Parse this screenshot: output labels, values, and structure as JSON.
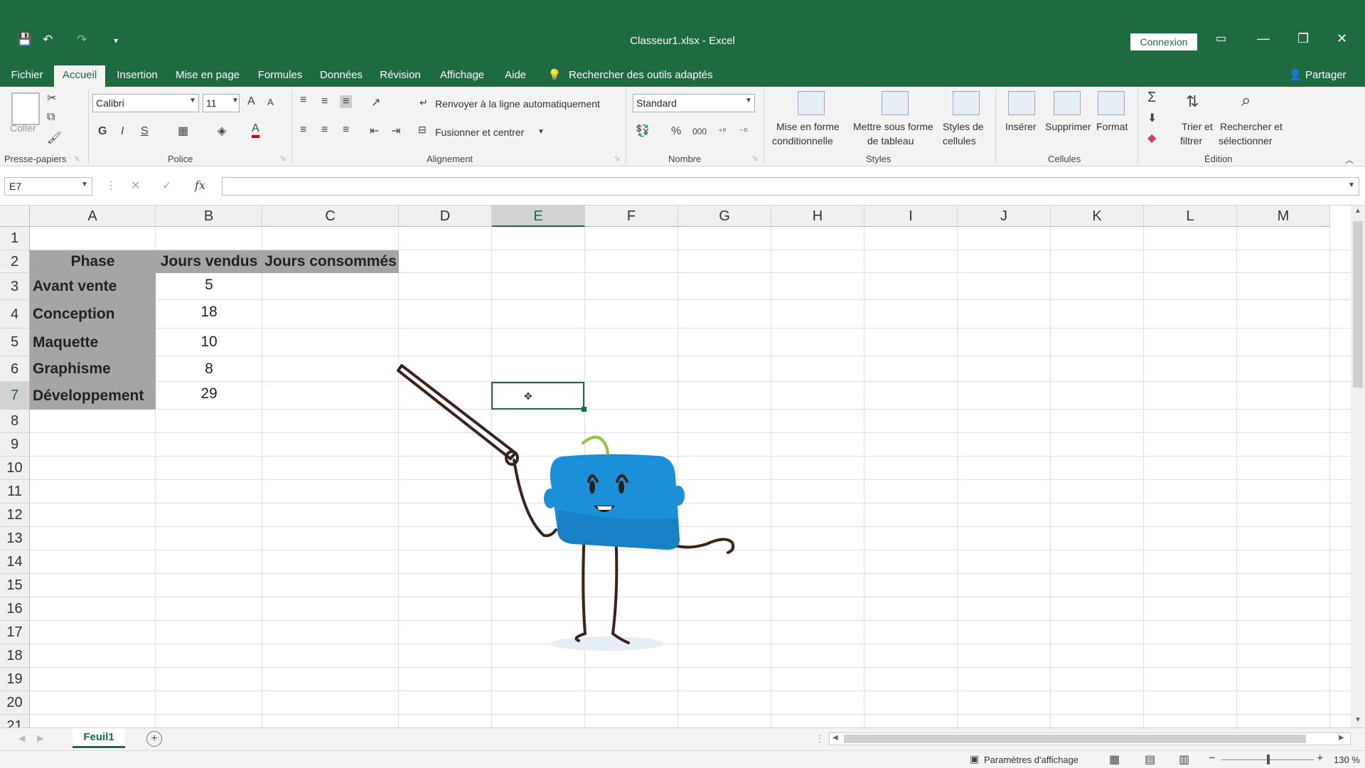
{
  "app": {
    "title": "Classeur1.xlsx  -  Excel",
    "connexion": "Connexion",
    "icons": [
      "save-icon",
      "undo-icon",
      "redo-icon",
      "customize-icon",
      "ribbon-display-icon",
      "minimize-icon",
      "restore-icon",
      "close-icon"
    ]
  },
  "tabs": [
    "Fichier",
    "Accueil",
    "Insertion",
    "Mise en page",
    "Formules",
    "Données",
    "Révision",
    "Affichage",
    "Aide"
  ],
  "tellme": "Rechercher des outils adaptés",
  "share": "Partager",
  "ribbon": {
    "clipboard": {
      "paste": "Coller",
      "group": "Presse-papiers"
    },
    "font": {
      "name": "Calibri",
      "size": "11",
      "bold": "G",
      "italic": "I",
      "underline": "S",
      "group": "Police"
    },
    "alignment": {
      "wrap": "Renvoyer à la ligne automatiquement",
      "merge": "Fusionner et centrer",
      "group": "Alignement"
    },
    "number": {
      "format": "Standard",
      "percent": "%",
      "thousands": "000",
      "group": "Nombre"
    },
    "styles": {
      "cond1": "Mise en forme",
      "cond2": "conditionnelle",
      "table1": "Mettre sous forme",
      "table2": "de tableau",
      "cell1": "Styles de",
      "cell2": "cellules",
      "group": "Styles"
    },
    "cells": {
      "insert": "Insérer",
      "delete": "Supprimer",
      "format": "Format",
      "group": "Cellules"
    },
    "editing": {
      "sum": "Σ",
      "sort1": "Trier et",
      "sort2": "filtrer",
      "find1": "Rechercher et",
      "find2": "sélectionner",
      "group": "Édition"
    }
  },
  "formula_bar": {
    "name_box": "E7",
    "fx": "fx",
    "value": ""
  },
  "grid": {
    "columns": [
      "A",
      "B",
      "C",
      "D",
      "E",
      "F",
      "G",
      "H",
      "I",
      "J",
      "K",
      "L",
      "M"
    ],
    "rows": [
      "1",
      "2",
      "3",
      "4",
      "5",
      "6",
      "7",
      "8",
      "9",
      "10",
      "11",
      "12",
      "13",
      "14",
      "15",
      "16",
      "17",
      "18",
      "19",
      "20",
      "21"
    ],
    "selected_column": "E",
    "selected_row": "7",
    "headers": [
      "Phase",
      "Jours vendus",
      "Jours consommés"
    ],
    "data": [
      {
        "phase": "Avant vente",
        "vendus": "5"
      },
      {
        "phase": "Conception",
        "vendus": "18"
      },
      {
        "phase": "Maquette",
        "vendus": "10"
      },
      {
        "phase": "Graphisme",
        "vendus": "8"
      },
      {
        "phase": "Développement",
        "vendus": "29"
      }
    ]
  },
  "sheets": [
    "Feuil1"
  ],
  "status": {
    "display_settings": "Paramètres d'affichage",
    "zoom": "130 %"
  },
  "colors": {
    "excel_green": "#1e6b41",
    "header_fill": "#a5a5a5",
    "mascot_blue": "#1b8fd8"
  }
}
